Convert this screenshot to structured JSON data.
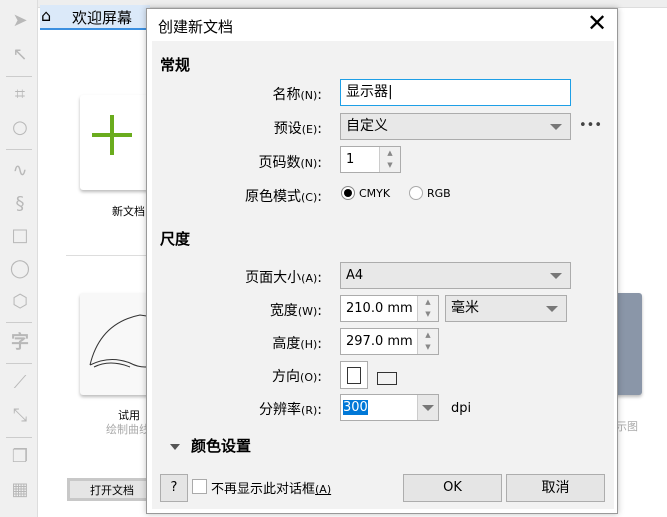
{
  "toolbar": {
    "tools": [
      "pick-tool",
      "shape-tool",
      "crop-tool",
      "zoom-tool",
      "freehand-tool",
      "artistic-media-tool",
      "rectangle-tool",
      "ellipse-tool",
      "polygon-tool",
      "text-tool",
      "dimension-tool",
      "connector-tool",
      "drop-shadow-tool",
      "transparency-tool"
    ],
    "text_glyph": "字"
  },
  "tab": {
    "label": "欢迎屏幕"
  },
  "welcome": {
    "new_doc": "新文档",
    "try_title": "试用",
    "try_sub": "绘制曲线",
    "open_button": "打开文档",
    "right_caption": "示图"
  },
  "dialog": {
    "title": "创建新文档",
    "general": {
      "heading": "常规",
      "name_label": "名称",
      "name_key": "(N)",
      "name_value": "显示器",
      "preset_label": "预设",
      "preset_key": "(E)",
      "preset_value": "自定义",
      "more": "•••",
      "pages_label": "页码数",
      "pages_key": "(N)",
      "pages_value": "1",
      "color_mode_label": "原色模式",
      "color_mode_key": "(C)",
      "color_modes": [
        "CMYK",
        "RGB"
      ],
      "color_mode_selected": "CMYK"
    },
    "dimensions": {
      "heading": "尺度",
      "size_label": "页面大小",
      "size_key": "(A)",
      "size_value": "A4",
      "width_label": "宽度",
      "width_key": "(W)",
      "width_value": "210.0 mm",
      "unit_value": "毫米",
      "height_label": "高度",
      "height_key": "(H)",
      "height_value": "297.0 mm",
      "orient_label": "方向",
      "orient_key": "(O)",
      "orientation": "portrait",
      "res_label": "分辨率",
      "res_key": "(R)",
      "res_value": "300",
      "res_unit": "dpi"
    },
    "color_settings": "颜色设置",
    "help": "?",
    "dont_show": "不再显示此对话框",
    "dont_show_key": "(A)",
    "ok": "OK",
    "cancel": "取消"
  }
}
